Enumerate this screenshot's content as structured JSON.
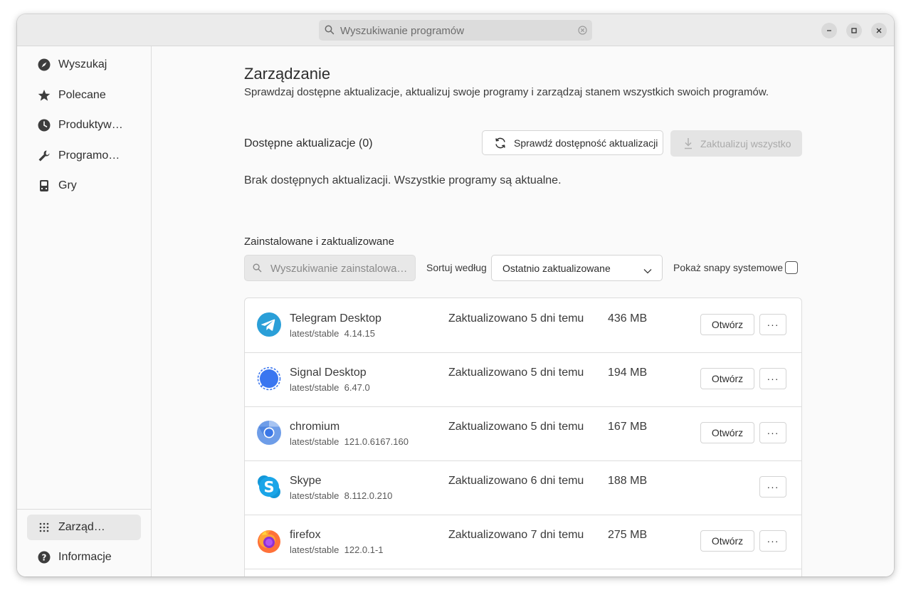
{
  "titlebar": {
    "search_placeholder": "Wyszukiwanie programów"
  },
  "sidebar": {
    "items": [
      {
        "label": "Wyszukaj",
        "icon": "compass-icon"
      },
      {
        "label": "Polecane",
        "icon": "star-icon"
      },
      {
        "label": "Produktyw…",
        "icon": "clock-icon"
      },
      {
        "label": "Programo…",
        "icon": "wrench-icon"
      },
      {
        "label": "Gry",
        "icon": "gamepad-icon"
      }
    ],
    "bottom_items": [
      {
        "label": "Zarząd…",
        "icon": "grid-icon",
        "active": true
      },
      {
        "label": "Informacje",
        "icon": "help-icon"
      }
    ]
  },
  "main": {
    "title": "Zarządzanie",
    "subtitle": "Sprawdzaj dostępne aktualizacje, aktualizuj swoje programy i zarządzaj stanem wszystkich swoich programów.",
    "updates_title": "Dostępne aktualizacje (0)",
    "check_button": "Sprawdź dostępność aktualizacji",
    "update_all_button": "Zaktualizuj wszystko",
    "no_updates": "Brak dostępnych aktualizacji. Wszystkie programy są aktualne.",
    "installed_title": "Zainstalowane i zaktualizowane",
    "installed_search_placeholder": "Wyszukiwanie zainstalowa…",
    "sort_label": "Sortuj według",
    "sort_value": "Ostatnio zaktualizowane",
    "show_system_snaps": "Pokaż snapy systemowe",
    "show_system_snaps_checked": false
  },
  "apps": [
    {
      "name": "Telegram Desktop",
      "channel": "latest/stable",
      "version": "4.14.15",
      "updated": "Zaktualizowano 5 dni temu",
      "size": "436 MB",
      "open": "Otwórz",
      "more": "···",
      "icon": "telegram-icon"
    },
    {
      "name": "Signal Desktop",
      "channel": "latest/stable",
      "version": "6.47.0",
      "updated": "Zaktualizowano 5 dni temu",
      "size": "194 MB",
      "open": "Otwórz",
      "more": "···",
      "icon": "signal-icon"
    },
    {
      "name": "chromium",
      "channel": "latest/stable",
      "version": "121.0.6167.160",
      "updated": "Zaktualizowano 5 dni temu",
      "size": "167 MB",
      "open": "Otwórz",
      "more": "···",
      "icon": "chromium-icon"
    },
    {
      "name": "Skype",
      "channel": "latest/stable",
      "version": "8.112.0.210",
      "updated": "Zaktualizowano 6 dni temu",
      "size": "188 MB",
      "open": "",
      "more": "···",
      "icon": "skype-icon"
    },
    {
      "name": "firefox",
      "channel": "latest/stable",
      "version": "122.0.1-1",
      "updated": "Zaktualizowano 7 dni temu",
      "size": "275 MB",
      "open": "Otwórz",
      "more": "···",
      "icon": "firefox-icon"
    }
  ]
}
